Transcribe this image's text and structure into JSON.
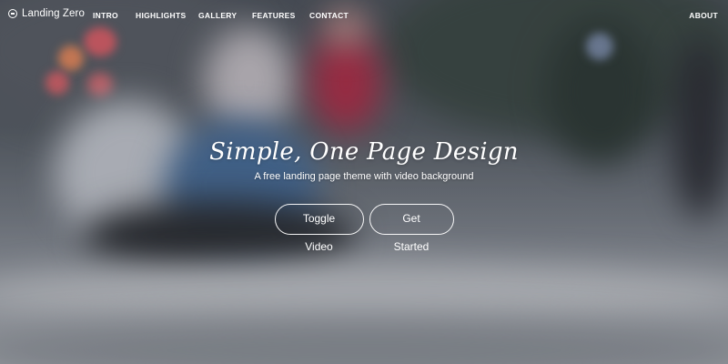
{
  "navbar": {
    "brand": {
      "text": "Landing Zero",
      "icon": "logo-circle-icon"
    },
    "links": [
      "INTRO",
      "HIGHLIGHTS",
      "GALLERY",
      "FEATURES",
      "CONTACT"
    ],
    "right_link": "ABOUT"
  },
  "hero": {
    "title": "Simple, One Page Design",
    "subtitle": "A free landing page theme with video background",
    "buttons": {
      "toggle_video": "Toggle Video",
      "get_started": "Get Started"
    }
  },
  "colors": {
    "text": "#ffffff",
    "button_border": "#ffffff"
  }
}
